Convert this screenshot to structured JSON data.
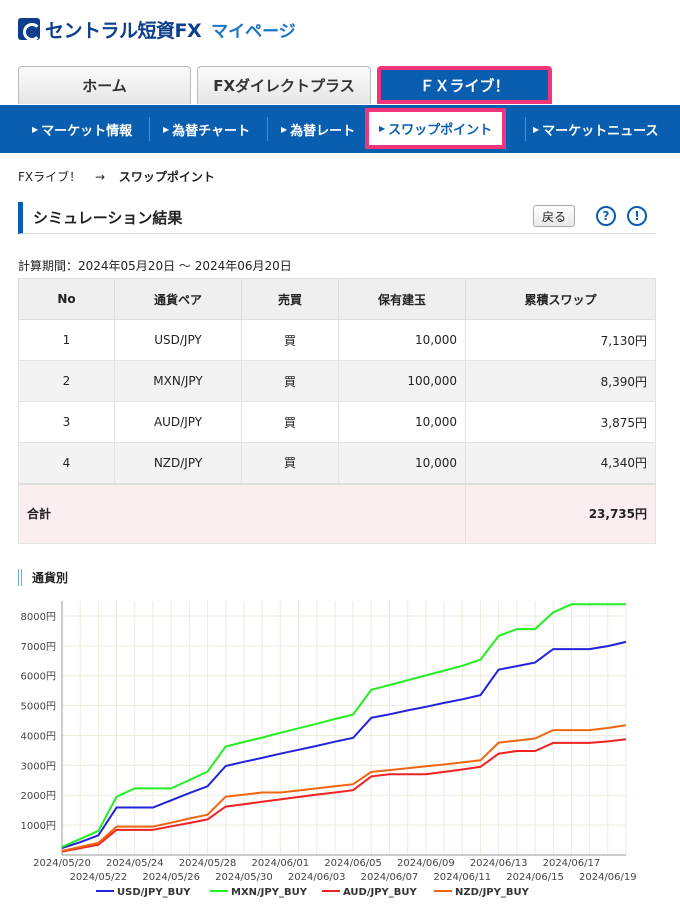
{
  "header": {
    "logo_text": "セントラル短資FX",
    "mypage_label": "マイページ"
  },
  "tabs": [
    {
      "label": "ホーム"
    },
    {
      "label": "FXダイレクトプラス"
    },
    {
      "label": "ＦＸライブ！"
    }
  ],
  "subnav": [
    {
      "label": "マーケット情報"
    },
    {
      "label": "為替チャート"
    },
    {
      "label": "為替レート"
    },
    {
      "label": "スワップポイント"
    },
    {
      "label": "マーケットニュース"
    }
  ],
  "breadcrumb": {
    "parent": "FXライブ！",
    "separator": "→",
    "current": "スワップポイント"
  },
  "section": {
    "title": "シミュレーション結果",
    "back_label": "戻る",
    "help_icon": "?",
    "info_icon": "!"
  },
  "period_label": "計算期間：2024年05月20日 〜 2024年06月20日",
  "table": {
    "headers": [
      "No",
      "通貨ペア",
      "売買",
      "保有建玉",
      "累積スワップ"
    ],
    "rows": [
      {
        "no": "1",
        "pair": "USD/JPY",
        "side": "買",
        "position": "10,000",
        "swap": "7,130円"
      },
      {
        "no": "2",
        "pair": "MXN/JPY",
        "side": "買",
        "position": "100,000",
        "swap": "8,390円"
      },
      {
        "no": "3",
        "pair": "AUD/JPY",
        "side": "買",
        "position": "10,000",
        "swap": "3,875円"
      },
      {
        "no": "4",
        "pair": "NZD/JPY",
        "side": "買",
        "position": "10,000",
        "swap": "4,340円"
      }
    ],
    "total_label": "合計",
    "total_value": "23,735円"
  },
  "chart_title": "通貨別",
  "chart_data": {
    "type": "line",
    "x": [
      "2024/05/20",
      "2024/05/21",
      "2024/05/22",
      "2024/05/23",
      "2024/05/24",
      "2024/05/25",
      "2024/05/26",
      "2024/05/27",
      "2024/05/28",
      "2024/05/29",
      "2024/05/30",
      "2024/05/31",
      "2024/06/01",
      "2024/06/02",
      "2024/06/03",
      "2024/06/04",
      "2024/06/05",
      "2024/06/06",
      "2024/06/07",
      "2024/06/08",
      "2024/06/09",
      "2024/06/10",
      "2024/06/11",
      "2024/06/12",
      "2024/06/13",
      "2024/06/14",
      "2024/06/15",
      "2024/06/16",
      "2024/06/17",
      "2024/06/18",
      "2024/06/19",
      "2024/06/20"
    ],
    "x_tick_labels": [
      "2024/05/20",
      "2024/05/22",
      "2024/05/24",
      "2024/05/26",
      "2024/05/28",
      "2024/05/30",
      "2024/06/01",
      "2024/06/03",
      "2024/06/05",
      "2024/06/07",
      "2024/06/09",
      "2024/06/11",
      "2024/06/13",
      "2024/06/15",
      "2024/06/17",
      "2024/06/19"
    ],
    "y_tick_labels": [
      "1000円",
      "2000円",
      "3000円",
      "4000円",
      "5000円",
      "6000円",
      "7000円",
      "8000円"
    ],
    "ylim": [
      0,
      8500
    ],
    "grid": true,
    "legend_position": "bottom",
    "series": [
      {
        "name": "USD/JPY_BUY",
        "color": "#2222dd",
        "values": [
          230,
          430,
          660,
          1590,
          1590,
          1590,
          1830,
          2070,
          2300,
          2980,
          3120,
          3250,
          3390,
          3520,
          3650,
          3790,
          3920,
          4590,
          4710,
          4840,
          4960,
          5090,
          5210,
          5350,
          6200,
          6320,
          6440,
          6890,
          6890,
          6890,
          6990,
          7130
        ]
      },
      {
        "name": "MXN/JPY_BUY",
        "color": "#22ee22",
        "values": [
          270,
          540,
          810,
          1950,
          2230,
          2230,
          2230,
          2510,
          2790,
          3630,
          3780,
          3930,
          4090,
          4240,
          4390,
          4550,
          4700,
          5530,
          5690,
          5850,
          6010,
          6170,
          6330,
          6540,
          7330,
          7560,
          7560,
          8120,
          8390,
          8390,
          8390,
          8390
        ]
      },
      {
        "name": "AUD/JPY_BUY",
        "color": "#ee2222",
        "values": [
          115,
          230,
          345,
          840,
          840,
          840,
          960,
          1070,
          1190,
          1620,
          1700,
          1780,
          1860,
          1940,
          2020,
          2090,
          2170,
          2630,
          2700,
          2700,
          2700,
          2780,
          2860,
          2950,
          3390,
          3480,
          3480,
          3750,
          3750,
          3750,
          3800,
          3875
        ]
      },
      {
        "name": "NZD/JPY_BUY",
        "color": "#ee6611",
        "values": [
          135,
          270,
          405,
          950,
          950,
          950,
          1080,
          1220,
          1350,
          1950,
          2020,
          2090,
          2090,
          2160,
          2230,
          2300,
          2370,
          2780,
          2840,
          2900,
          2970,
          3030,
          3100,
          3170,
          3760,
          3830,
          3900,
          4180,
          4180,
          4180,
          4250,
          4340
        ]
      }
    ]
  }
}
